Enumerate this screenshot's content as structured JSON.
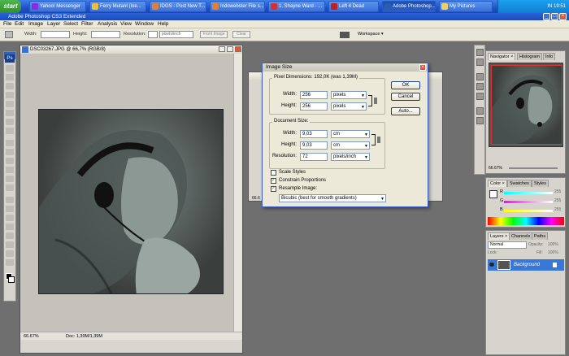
{
  "taskbar": {
    "start": "start",
    "items": [
      {
        "label": "Yahoo! Messenger",
        "icon": "yahoo-icon",
        "color": "#8a2be2"
      },
      {
        "label": "Ferry Mutant (loe...",
        "icon": "yahoo-icon",
        "color": "#f0c030"
      },
      {
        "label": "IDGS - Post New T...",
        "icon": "firefox-icon",
        "color": "#e08030"
      },
      {
        "label": "Indowebster File s...",
        "icon": "firefox-icon",
        "color": "#e08030"
      },
      {
        "label": "1. Shayne Ward - ...",
        "icon": "media-icon",
        "color": "#d83030"
      },
      {
        "label": "Left 4 Dead",
        "icon": "game-icon",
        "color": "#c02020"
      },
      {
        "label": "Adobe Photoshop...",
        "icon": "photoshop-icon",
        "color": "#2a5fb0"
      },
      {
        "label": "My Pictures",
        "icon": "folder-icon",
        "color": "#f0d060"
      }
    ],
    "tray": "IN  19:51"
  },
  "app": {
    "title": "Adobe Photoshop CS3 Extended",
    "menus": [
      "File",
      "Edit",
      "Image",
      "Layer",
      "Select",
      "Filter",
      "Analysis",
      "View",
      "Window",
      "Help"
    ],
    "options": {
      "width_label": "Width:",
      "height_label": "Height:",
      "resolution_label": "Resolution:",
      "resolution_unit": "pixels/inch",
      "front_image": "Front Image",
      "clear": "Clear",
      "workspace": "Workspace ▾"
    },
    "ps_logo": "Ps"
  },
  "document": {
    "title": "DSC03267.JPG @ 66,7% (RGB/8)",
    "zoom": "66.67%",
    "doc_info": "Doc: 1,39M/1,39M",
    "zoom2": "66.6"
  },
  "dialog": {
    "title": "Image Size",
    "pixel_dimensions": "Pixel Dimensions:  192,0K (was 1,39M)",
    "width_label": "Width:",
    "width_value": "256",
    "width_unit": "pixels",
    "height_label": "Height:",
    "height_value": "256",
    "height_unit": "pixels",
    "document_size": "Document Size:",
    "doc_width_label": "Width:",
    "doc_width_value": "9,03",
    "doc_width_unit": "cm",
    "doc_height_label": "Height:",
    "doc_height_value": "9,03",
    "doc_height_unit": "cm",
    "resolution_label": "Resolution:",
    "resolution_value": "72",
    "resolution_unit": "pixels/inch",
    "scale_styles": "Scale Styles",
    "constrain": "Constrain Proportions",
    "resample": "Resample Image:",
    "resample_method": "Bicubic (best for smooth gradients)",
    "ok": "OK",
    "cancel": "Cancel",
    "auto": "Auto..."
  },
  "navigator": {
    "tabs": [
      "Navigator ×",
      "Histogram",
      "Info"
    ],
    "zoom": "66.67%"
  },
  "color_panel": {
    "tabs": [
      "Color ×",
      "Swatches",
      "Styles"
    ],
    "r_label": "R",
    "g_label": "G",
    "b_label": "B",
    "r_value": "255",
    "g_value": "255",
    "b_value": "255"
  },
  "layers_panel": {
    "tabs": [
      "Layers ×",
      "Channels",
      "Paths"
    ],
    "blend_mode": "Normal",
    "opacity_label": "Opacity:",
    "opacity_value": "100%",
    "lock_label": "Lock:",
    "fill_label": "Fill:",
    "fill_value": "100%",
    "layer_name": "Background"
  },
  "colors": {
    "accent": "#316ac5",
    "selected_layer": "#3a78d8"
  }
}
